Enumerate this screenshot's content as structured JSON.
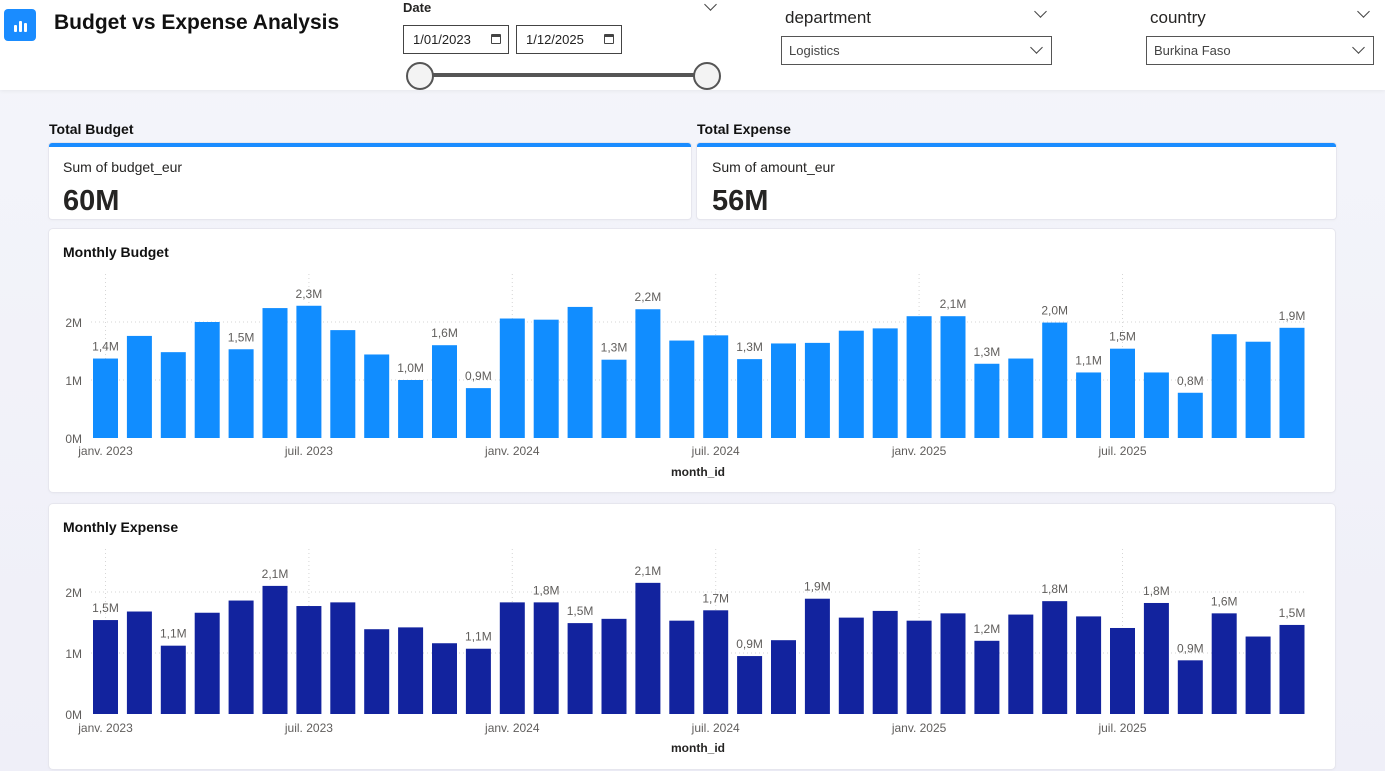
{
  "header": {
    "title": "Budget vs Expense Analysis",
    "icon": "bar-chart-icon",
    "accent": "#1a8cff"
  },
  "filters": {
    "date": {
      "label": "Date",
      "start": "1/01/2023",
      "end": "1/12/2025"
    },
    "department": {
      "label": "department",
      "value": "Logistics"
    },
    "country": {
      "label": "country",
      "value": "Burkina Faso"
    }
  },
  "kpis": {
    "budget": {
      "title": "Total Budget",
      "subtitle": "Sum of budget_eur",
      "value": "60M"
    },
    "expense": {
      "title": "Total Expense",
      "subtitle": "Sum of amount_eur",
      "value": "56M"
    }
  },
  "chart_data": [
    {
      "type": "bar",
      "title": "Monthly Budget",
      "xlabel": "month_id",
      "ylabel": "",
      "color": "#118dff",
      "ylim": [
        0,
        2.45
      ],
      "yticks": [
        "0M",
        "1M",
        "2M"
      ],
      "xticks": [
        {
          "index": 0,
          "label": "janv. 2023"
        },
        {
          "index": 6,
          "label": "juil. 2023"
        },
        {
          "index": 12,
          "label": "janv. 2024"
        },
        {
          "index": 18,
          "label": "juil. 2024"
        },
        {
          "index": 24,
          "label": "janv. 2025"
        },
        {
          "index": 30,
          "label": "juil. 2025"
        }
      ],
      "categories": [
        "2023-01",
        "2023-02",
        "2023-03",
        "2023-04",
        "2023-05",
        "2023-06",
        "2023-07",
        "2023-08",
        "2023-09",
        "2023-10",
        "2023-11",
        "2023-12",
        "2024-01",
        "2024-02",
        "2024-03",
        "2024-04",
        "2024-05",
        "2024-06",
        "2024-07",
        "2024-08",
        "2024-09",
        "2024-10",
        "2024-11",
        "2024-12",
        "2025-01",
        "2025-02",
        "2025-03",
        "2025-04",
        "2025-05",
        "2025-06",
        "2025-07",
        "2025-08",
        "2025-09",
        "2025-10",
        "2025-11",
        "2025-12"
      ],
      "values": [
        1.37,
        1.76,
        1.48,
        2.0,
        1.53,
        2.24,
        2.28,
        1.86,
        1.44,
        1.0,
        1.6,
        0.86,
        2.06,
        2.04,
        2.26,
        1.35,
        2.22,
        1.68,
        1.77,
        1.36,
        1.63,
        1.64,
        1.85,
        1.89,
        2.1,
        2.1,
        1.28,
        1.37,
        1.99,
        1.13,
        1.54,
        1.13,
        0.78,
        1.79,
        1.66,
        1.9
      ],
      "data_labels": {
        "0": "1,4M",
        "4": "1,5M",
        "6": "2,3M",
        "9": "1,0M",
        "10": "1,6M",
        "11": "0,9M",
        "15": "1,3M",
        "16": "2,2M",
        "19": "1,3M",
        "25": "2,1M",
        "26": "1,3M",
        "28": "2,0M",
        "29": "1,1M",
        "30": "1,5M",
        "32": "0,8M",
        "35": "1,9M"
      }
    },
    {
      "type": "bar",
      "title": "Monthly Expense",
      "xlabel": "month_id",
      "ylabel": "",
      "color": "#12239e",
      "ylim": [
        0,
        2.45
      ],
      "yticks": [
        "0M",
        "1M",
        "2M"
      ],
      "xticks": [
        {
          "index": 0,
          "label": "janv. 2023"
        },
        {
          "index": 6,
          "label": "juil. 2023"
        },
        {
          "index": 12,
          "label": "janv. 2024"
        },
        {
          "index": 18,
          "label": "juil. 2024"
        },
        {
          "index": 24,
          "label": "janv. 2025"
        },
        {
          "index": 30,
          "label": "juil. 2025"
        }
      ],
      "categories": [
        "2023-01",
        "2023-02",
        "2023-03",
        "2023-04",
        "2023-05",
        "2023-06",
        "2023-07",
        "2023-08",
        "2023-09",
        "2023-10",
        "2023-11",
        "2023-12",
        "2024-01",
        "2024-02",
        "2024-03",
        "2024-04",
        "2024-05",
        "2024-06",
        "2024-07",
        "2024-08",
        "2024-09",
        "2024-10",
        "2024-11",
        "2024-12",
        "2025-01",
        "2025-02",
        "2025-03",
        "2025-04",
        "2025-05",
        "2025-06",
        "2025-07",
        "2025-08",
        "2025-09",
        "2025-10",
        "2025-11",
        "2025-12"
      ],
      "values": [
        1.54,
        1.68,
        1.12,
        1.66,
        1.86,
        2.1,
        1.77,
        1.83,
        1.39,
        1.42,
        1.16,
        1.07,
        1.83,
        1.83,
        1.49,
        1.56,
        2.15,
        1.53,
        1.7,
        0.95,
        1.21,
        1.89,
        1.58,
        1.69,
        1.53,
        1.65,
        1.2,
        1.63,
        1.85,
        1.6,
        1.41,
        1.82,
        0.88,
        1.65,
        1.27,
        1.46
      ],
      "data_labels": {
        "0": "1,5M",
        "2": "1,1M",
        "5": "2,1M",
        "11": "1,1M",
        "13": "1,8M",
        "14": "1,5M",
        "16": "2,1M",
        "18": "1,7M",
        "19": "0,9M",
        "21": "1,9M",
        "26": "1,2M",
        "28": "1,8M",
        "31": "1,8M",
        "32": "0,9M",
        "33": "1,6M",
        "35": "1,5M"
      }
    }
  ]
}
